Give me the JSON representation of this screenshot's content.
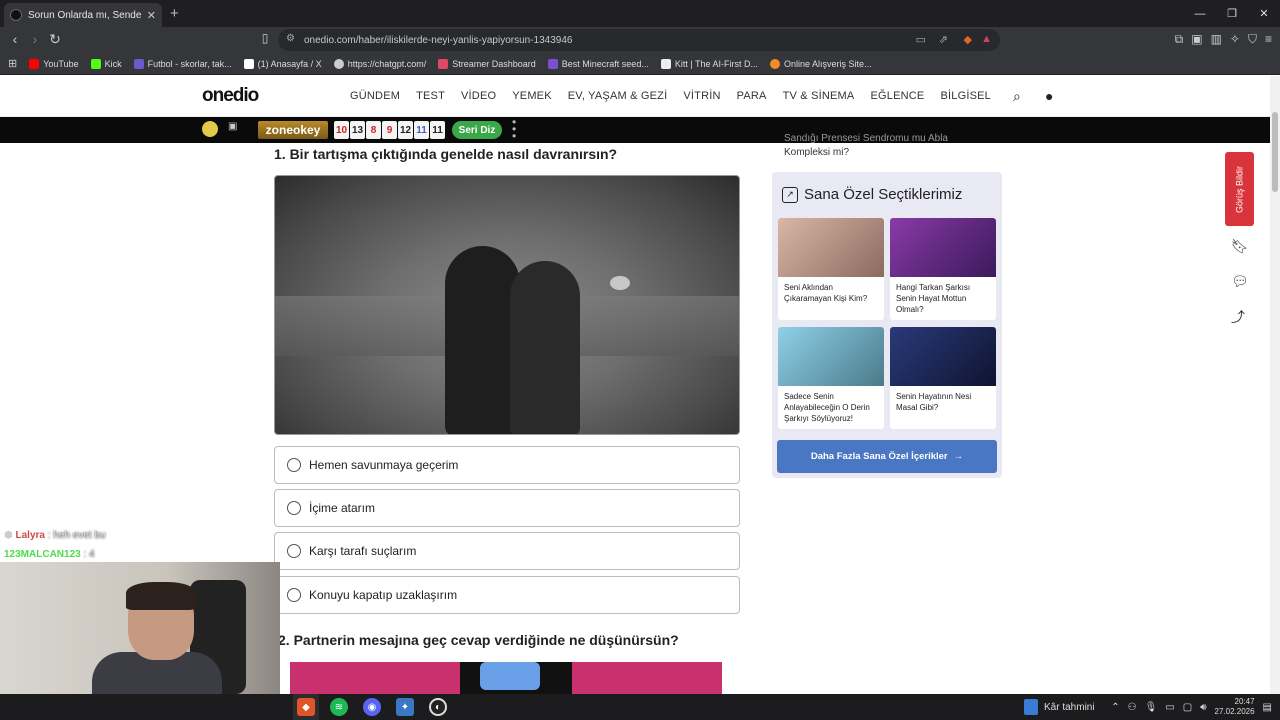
{
  "browser": {
    "tab_title": "Sorun Onlarda mı, Sende mi? - O",
    "new_tab": "+",
    "url": "onedio.com/haber/iliskilerde-neyi-yanlis-yapiyorsun-1343946",
    "bookmarks": [
      {
        "label": "YouTube",
        "color": "#ff0000"
      },
      {
        "label": "Kick",
        "color": "#53fc18"
      },
      {
        "label": "Futbol - skorlar, tak...",
        "color": "#6a5acd"
      },
      {
        "label": "(1) Anasayfa / X",
        "color": "#ffffff"
      },
      {
        "label": "https://chatgpt.com/",
        "color": "#cccccc"
      },
      {
        "label": "Streamer Dashboard",
        "color": "#e04a6a"
      },
      {
        "label": "Best Minecraft seed...",
        "color": "#7a4fd1"
      },
      {
        "label": "Kitt | The AI-First D...",
        "color": "#eeeeee"
      },
      {
        "label": "Online Alışveriş Site...",
        "color": "#f28c28"
      }
    ]
  },
  "site": {
    "logo": "onedio",
    "nav": [
      "GÜNDEM",
      "TEST",
      "VİDEO",
      "YEMEK",
      "EV, YAŞAM & GEZİ",
      "VİTRİN",
      "PARA",
      "TV & SİNEMA",
      "EĞLENCE",
      "BİLGİSEL"
    ],
    "promo": {
      "zone_label": "zoneokey",
      "tiles": [
        "10",
        "13",
        "8",
        "9",
        "12",
        "11",
        "11"
      ],
      "tile_colors": [
        "#c22",
        "#222",
        "#c22",
        "#c22",
        "#222",
        "#3a5fcf",
        "#222"
      ],
      "button": "Seri Diz"
    }
  },
  "question1": {
    "title": "1. Bir tartışma çıktığında genelde nasıl davranırsın?",
    "options": [
      "Hemen savunmaya geçerim",
      "İçime atarım",
      "Karşı tarafı suçlarım",
      "Konuyu kapatıp uzaklaşırım"
    ]
  },
  "question2": {
    "title": "2. Partnerin mesajına geç cevap verdiğinde ne düşünürsün?"
  },
  "sidebar": {
    "top_link_faded": "Sandığı Prensesi Sendromu mu Abla",
    "top_link": "Kompleksi mi?",
    "card_title": "Sana Özel Seçtiklerimiz",
    "items": [
      {
        "title": "Seni Aklından Çıkaramayan Kişi Kim?",
        "thumb": "#a88a7c"
      },
      {
        "title": "Hangi Tarkan Şarkısı Senin Hayat Mottun Olmalı?",
        "thumb": "#6a2a8a"
      },
      {
        "title": "Sadece Senin Anlayabileceğin O Derin Şarkıyı Söylüyoruz!",
        "thumb": "#6bb8d8"
      },
      {
        "title": "Senin Hayatının Nesi Masal Gibi?",
        "thumb": "#1f2a5a"
      }
    ],
    "more_button": "Daha Fazla Sana Özel İçerikler",
    "feedback": "Görüş Bildir"
  },
  "stream_chat": [
    {
      "user": "Lalyra",
      "message": ": heh evet bu"
    },
    {
      "user": "123MALCAN123",
      "message": ": 4"
    }
  ],
  "taskbar": {
    "weather": "Kâr tahmini",
    "time": "20:47",
    "date": "27.02.2026"
  }
}
